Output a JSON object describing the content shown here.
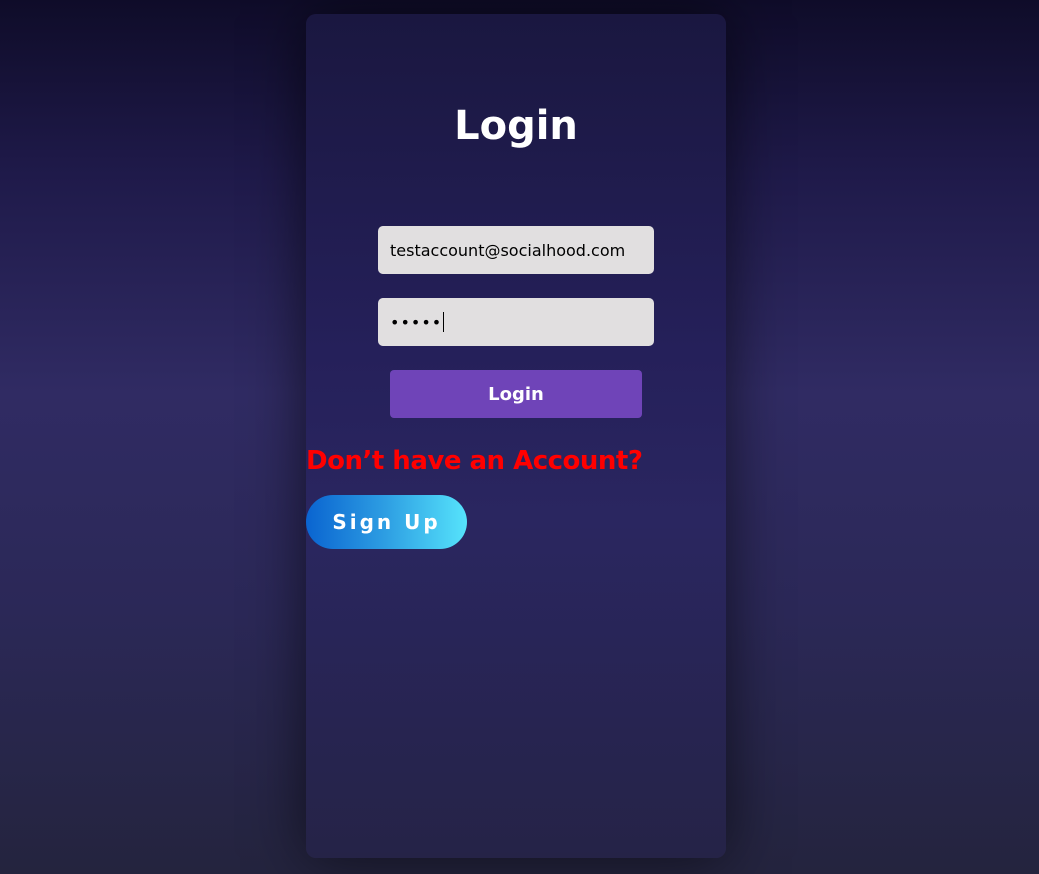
{
  "login_card": {
    "title": "Login",
    "email_value": "testaccount@socialhood.com",
    "password_masked": "•••••",
    "login_button_label": "Login",
    "no_account_text": "Don’t have an Account?",
    "signup_button_label": "Sign Up"
  },
  "colors": {
    "login_button": "#6f44b8",
    "no_account_text": "#ff0000",
    "signup_gradient_start": "#0a64d0",
    "signup_gradient_end": "#56e3fb",
    "input_background": "#e1dfe0"
  }
}
